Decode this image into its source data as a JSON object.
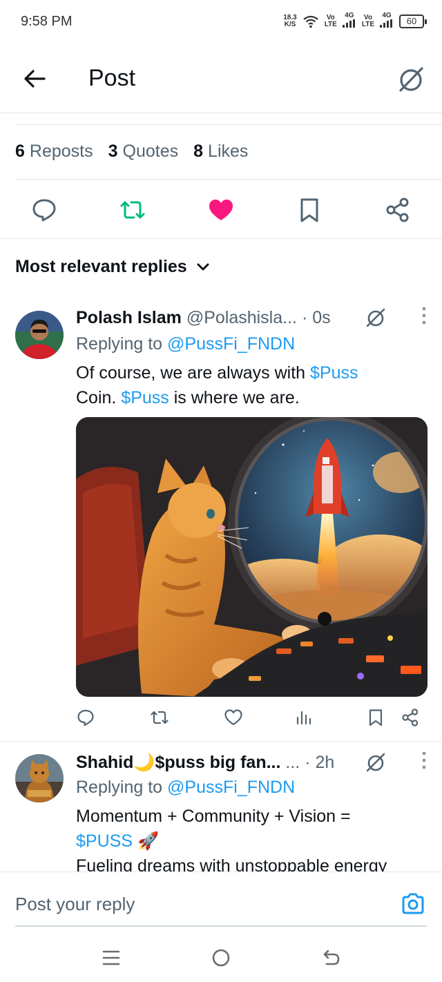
{
  "status_bar": {
    "time": "9:58 PM",
    "net_speed_value": "18.3",
    "net_speed_unit": "K/S",
    "sim1_label_top": "Vo",
    "sim1_label_bottom": "LTE",
    "sim1_net": "4G",
    "sim2_label_top": "Vo",
    "sim2_label_bottom": "LTE",
    "sim2_net": "4G",
    "battery": "60"
  },
  "header": {
    "title": "Post"
  },
  "stats": {
    "reposts_count": "6",
    "reposts_label": "Reposts",
    "quotes_count": "3",
    "quotes_label": "Quotes",
    "likes_count": "8",
    "likes_label": "Likes"
  },
  "colors": {
    "accent": "#1d9bf0",
    "like": "#f91880",
    "repost": "#00ba7c",
    "text_secondary": "#536471"
  },
  "replies_header": {
    "label": "Most relevant replies"
  },
  "replies": [
    {
      "name": "Polash Islam",
      "handle": "@Polashisla...",
      "time": "· 0s",
      "replying_prefix": "Replying to ",
      "replying_to": "@PussFi_FNDN",
      "text_1": "Of course, we are always with ",
      "cashtag_1": "$Puss",
      "text_2": "Coin. ",
      "cashtag_2": "$Puss",
      "text_3": " is where we are."
    },
    {
      "name": "Shahid🌙$puss big fan...",
      "ellipsis": "...",
      "time": "· 2h",
      "replying_prefix": "Replying to ",
      "replying_to": "@PussFi_FNDN",
      "text_1": "Momentum + Community + Vision =",
      "cashtag_1": "$PUSS",
      "emoji": "🚀",
      "text_2": "Fueling dreams with unstoppable energy"
    }
  ],
  "reply_bar": {
    "placeholder": "Post your reply"
  }
}
